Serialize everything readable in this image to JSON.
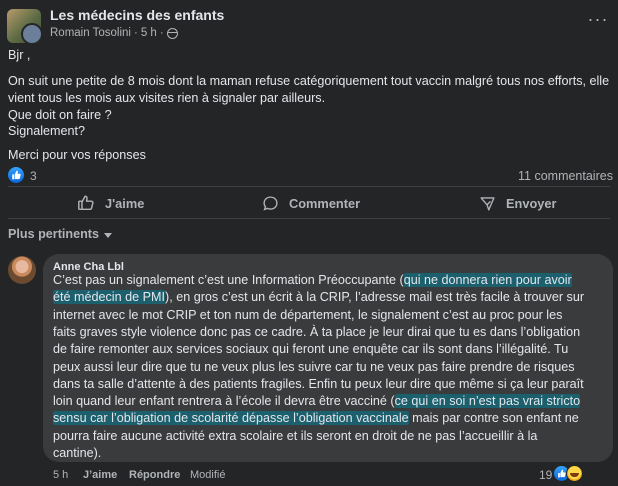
{
  "post": {
    "group_name": "Les médecins des enfants",
    "author": "Romain Tosolini",
    "separator": "·",
    "time": "5 h",
    "more_label": "···",
    "body_lines": [
      "Bjr ,",
      "On suit une petite de 8 mois dont la maman refuse catégoriquement tout vaccin malgré tous nos efforts, elle",
      "vient tous les mois aux visites rien à signaler par ailleurs.",
      "Que doit on faire ?",
      "Signalement?",
      "Merci pour vos réponses"
    ],
    "reaction_count": "3",
    "comments_count": "11 commentaires"
  },
  "actions": {
    "like": "J'aime",
    "comment": "Commenter",
    "send": "Envoyer"
  },
  "comments_sort": "Plus pertinents",
  "comment": {
    "author": "Anne Cha Lbl",
    "lines": [
      [
        {
          "t": "C’est pas un signalement c’est une Information Préoccupante (",
          "h": false
        },
        {
          "t": "qui ne donnera rien pour avoir",
          "h": true
        }
      ],
      [
        {
          "t": "été médecin de PMI",
          "h": true
        },
        {
          "t": "), en gros c’est un écrit à la CRIP, l’adresse mail est très facile à trouver sur",
          "h": false
        }
      ],
      [
        {
          "t": "internet avec le mot CRIP et ton num de département, le signalement c’est au proc pour les",
          "h": false
        }
      ],
      [
        {
          "t": "faits graves style violence donc pas ce cadre. À ta place je leur dirai que tu es dans l’obligation",
          "h": false
        }
      ],
      [
        {
          "t": "de faire remonter aux services sociaux qui feront une enquête car ils sont dans l’illégalité. Tu",
          "h": false
        }
      ],
      [
        {
          "t": "peux aussi leur dire que tu ne veux plus les suivre car tu ne veux pas faire prendre de risques",
          "h": false
        }
      ],
      [
        {
          "t": "dans ta salle d’attente à des patients fragiles. Enfin tu peux leur dire que même si ça leur paraît",
          "h": false
        }
      ],
      [
        {
          "t": "loin quand leur enfant rentrera à l’école il devra être vacciné (",
          "h": false
        },
        {
          "t": "ce qui en soi n’est pas vrai stricto",
          "h": true
        }
      ],
      [
        {
          "t": "sensu car l’obligation de scolarité dépasse l’obligation vaccinale",
          "h": true
        },
        {
          "t": " mais par contre son enfant ne",
          "h": false
        }
      ],
      [
        {
          "t": "pourra faire aucune activité extra scolaire et ils seront en droit de ne pas l’accueillir à la",
          "h": false
        }
      ],
      [
        {
          "t": "cantine).",
          "h": false
        }
      ]
    ],
    "time": "5 h",
    "like_label": "J’aime",
    "reply_label": "Répondre",
    "edited_label": "Modifié",
    "reaction_count": "19"
  },
  "colors": {
    "background": "#242526",
    "bubble": "#3a3b3c",
    "highlight": "#1c5f6d",
    "like_blue": "#1877f2"
  }
}
